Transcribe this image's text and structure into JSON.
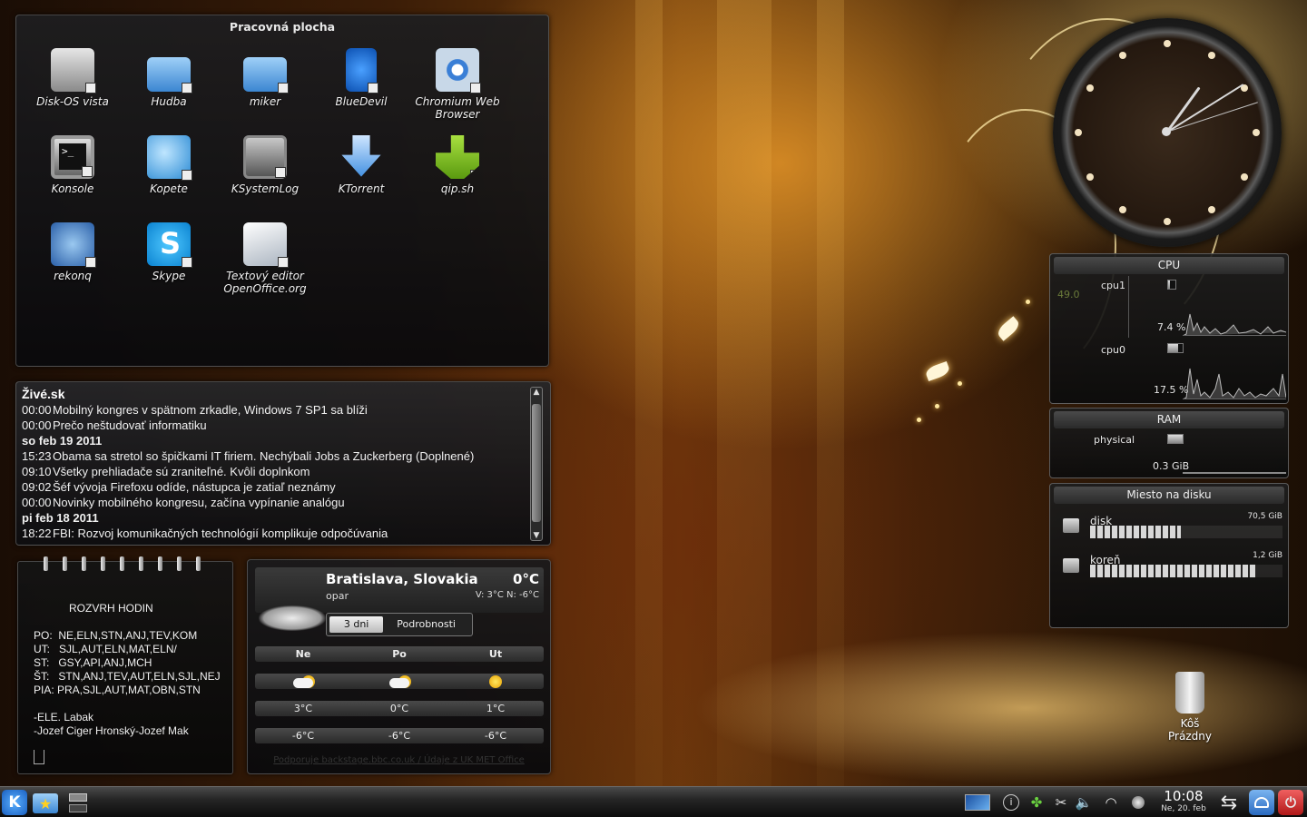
{
  "folder_view": {
    "title": "Pracovná plocha",
    "icons": [
      {
        "label": "Disk-OS vista",
        "icon": "hard-disk-icon"
      },
      {
        "label": "Hudba",
        "icon": "folder-icon"
      },
      {
        "label": "miker",
        "icon": "folder-icon"
      },
      {
        "label": "BlueDevil",
        "icon": "bluetooth-icon"
      },
      {
        "label": "Chromium Web Browser",
        "icon": "chromium-icon"
      },
      {
        "label": "Konsole",
        "icon": "terminal-icon"
      },
      {
        "label": "Kopete",
        "icon": "chat-icon"
      },
      {
        "label": "KSystemLog",
        "icon": "log-viewer-icon"
      },
      {
        "label": "KTorrent",
        "icon": "download-arrow-icon"
      },
      {
        "label": "qip.sh",
        "icon": "qip-flower-icon"
      },
      {
        "label": "rekonq",
        "icon": "browser-icon"
      },
      {
        "label": "Skype",
        "icon": "skype-icon"
      },
      {
        "label": "Textový editor OpenOffice.org",
        "icon": "writer-icon"
      }
    ]
  },
  "news": {
    "title": "Živé.sk",
    "items": [
      {
        "time": "00:00",
        "text": "Mobilný kongres v spätnom zrkadle, Windows 7 SP1 sa blíži"
      },
      {
        "time": "00:00",
        "text": "Prečo neštudovať informatiku"
      },
      {
        "date": "so feb 19 2011"
      },
      {
        "time": "15:23",
        "text": "Obama sa stretol so špičkami IT firiem. Nechýbali Jobs a Zuckerberg (Doplnené)"
      },
      {
        "time": "09:10",
        "text": "Všetky prehliadače sú zraniteľné. Kvôli doplnkom"
      },
      {
        "time": "09:02",
        "text": "Šéf vývoja Firefoxu odíde, nástupca je zatiaľ neznámy"
      },
      {
        "time": "00:00",
        "text": "Novinky mobilného kongresu, začína vypínanie analógu"
      },
      {
        "date": "pi feb 18 2011"
      },
      {
        "time": "18:22",
        "text": "FBI: Rozvoj komunikačných technológií komplikuje odpočúvania"
      }
    ]
  },
  "notes": {
    "lines": [
      "ROZVRH HODIN",
      "PO:  NE,ELN,STN,ANJ,TEV,KOM",
      "UT:   SJL,AUT,ELN,MAT,ELN/",
      "ST:   GSY,API,ANJ,MCH",
      "ŠT:   STN,ANJ,TEV,AUT,ELN,SJL,NEJ",
      "PIA: PRA,SJL,AUT,MAT,OBN,STN",
      "-ELE. Labak",
      "-Jozef Ciger Hronský-Jozef Mak"
    ]
  },
  "weather": {
    "city": "Bratislava, Slovakia",
    "temp": "0°C",
    "condition": "opar",
    "hi_lo": "V: 3°C N: -6°C",
    "tabs": [
      "3 dni",
      "Podrobnosti"
    ],
    "days": [
      "Ne",
      "Po",
      "Ut"
    ],
    "day_icons": [
      "partly-cloudy-icon",
      "partly-cloudy-icon",
      "sun-icon"
    ],
    "highs": [
      "3°C",
      "0°C",
      "1°C"
    ],
    "lows": [
      "-6°C",
      "-6°C",
      "-6°C"
    ],
    "footer": "Podporuje backstage.bbc.co.uk / Údaje z UK MET Office"
  },
  "sysmon": {
    "cpu": {
      "title": "CPU",
      "peak": "49.0",
      "cores": [
        {
          "name": "cpu1",
          "value": "7.4 %",
          "load": 7.4
        },
        {
          "name": "cpu0",
          "value": "17.5 %",
          "load": 17.5
        }
      ]
    },
    "ram": {
      "title": "RAM",
      "label": "physical",
      "value": "0.3 GiB"
    },
    "disk": {
      "title": "Miesto na disku",
      "items": [
        {
          "name": "disk",
          "size": "70,5 GiB",
          "used": 0.47
        },
        {
          "name": "koreň",
          "size": "1,2 GiB",
          "used": 0.87
        }
      ]
    }
  },
  "trash": {
    "label": "Kôš",
    "status": "Prázdny"
  },
  "taskbar": {
    "kmenu": "K",
    "time": "10:08",
    "date": "Ne, 20. feb"
  },
  "colors": {
    "accent": "#3a8ee0",
    "panel": "#141416",
    "wallpaper_glow": "#e8a030"
  }
}
